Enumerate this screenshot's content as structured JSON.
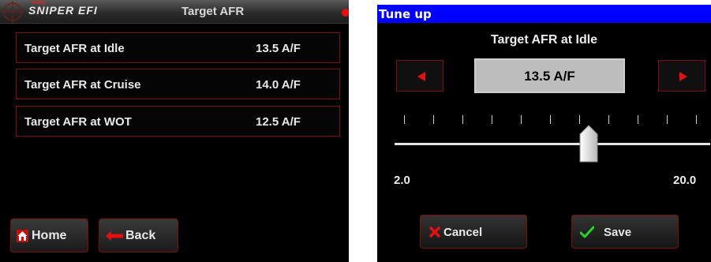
{
  "main_screen": {
    "header": {
      "brand_small": "Holley",
      "brand_logo": "SNIPER EFI",
      "title": "Target AFR",
      "status_color": "#e41010"
    },
    "items": [
      {
        "label": "Target AFR at Idle",
        "value": "13.5 A/F"
      },
      {
        "label": "Target AFR at Cruise",
        "value": "14.0 A/F"
      },
      {
        "label": "Target AFR at WOT",
        "value": "12.5 A/F"
      }
    ],
    "nav": {
      "home_label": "Home",
      "back_label": "Back"
    }
  },
  "tune_dialog": {
    "titlebar": "Tune up",
    "heading": "Target AFR at Idle",
    "value": "13.5 A/F",
    "slider": {
      "min": "2.0",
      "max": "20.0",
      "current": 13.5
    },
    "actions": {
      "cancel_label": "Cancel",
      "save_label": "Save"
    }
  },
  "icons": {
    "crosshair": "crosshair-icon",
    "home": "home-icon",
    "back": "back-arrow-icon",
    "left": "left-arrow-icon",
    "right": "right-arrow-icon",
    "cancel": "x-icon",
    "save": "checkmark-icon"
  },
  "colors": {
    "accent_red": "#e41010",
    "border_red": "#7a1010",
    "titlebar_blue": "#0000ff",
    "save_green": "#2bd32b"
  }
}
